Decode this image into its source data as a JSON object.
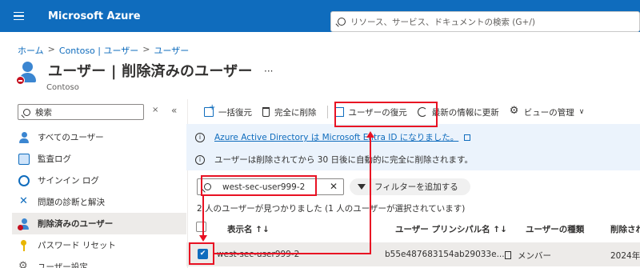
{
  "header": {
    "brand": "Microsoft Azure",
    "search_placeholder": "リソース、サービス、ドキュメントの検索 (G+/)"
  },
  "breadcrumb": [
    "ホーム",
    "Contoso | ユーザー",
    "ユーザー"
  ],
  "page": {
    "title": "ユーザー | 削除済みのユーザー",
    "subtitle": "Contoso",
    "more": "···"
  },
  "sidebar": {
    "search_value": "検索",
    "collapse": "×",
    "chevrons": "«",
    "items": [
      {
        "label": "すべてのユーザー",
        "icon": "user-icon"
      },
      {
        "label": "監査ログ",
        "icon": "log-icon"
      },
      {
        "label": "サインイン ログ",
        "icon": "signin-icon"
      },
      {
        "label": "問題の診断と解決",
        "icon": "tools-icon"
      },
      {
        "label": "削除済みのユーザー",
        "icon": "deleted-user-icon",
        "active": true
      },
      {
        "label": "パスワード リセット",
        "icon": "key-icon"
      },
      {
        "label": "ユーザー設定",
        "icon": "gear-icon"
      }
    ]
  },
  "toolbar": {
    "bulk_restore": "一括復元",
    "delete_permanently": "完全に削除",
    "restore_user": "ユーザーの復元",
    "refresh": "最新の情報に更新",
    "manage_view": "ビューの管理",
    "chev": "∨"
  },
  "banner": {
    "line1": "Azure Active Directory は Microsoft Entra ID になりました。",
    "line2": "ユーザーは削除されてから 30 日後に自動的に完全に削除されます。",
    "info_glyph": "i"
  },
  "filter": {
    "value": "west-sec-user999-2",
    "clear": "✕",
    "add_filter": "フィルターを追加する"
  },
  "result_count": "2 人のユーザーが見つかりました (1 人のユーザーが選択されています)",
  "table": {
    "headers": [
      "表示名 ↑↓",
      "ユーザー プリンシパル名 ↑↓",
      "ユーザーの種類",
      "削除され"
    ],
    "rows": [
      {
        "checked": true,
        "check_glyph": "✔",
        "display_name": "west-sec-user999-2",
        "upn": "b55e487683154ab29033e...",
        "type": "メンバー",
        "deleted": "2024年10"
      }
    ]
  },
  "colors": {
    "azure_blue": "#0f6cbd",
    "annotation_red": "#e81123",
    "banner_bg": "#ebf3fc",
    "selected_bg": "#edebe9"
  }
}
